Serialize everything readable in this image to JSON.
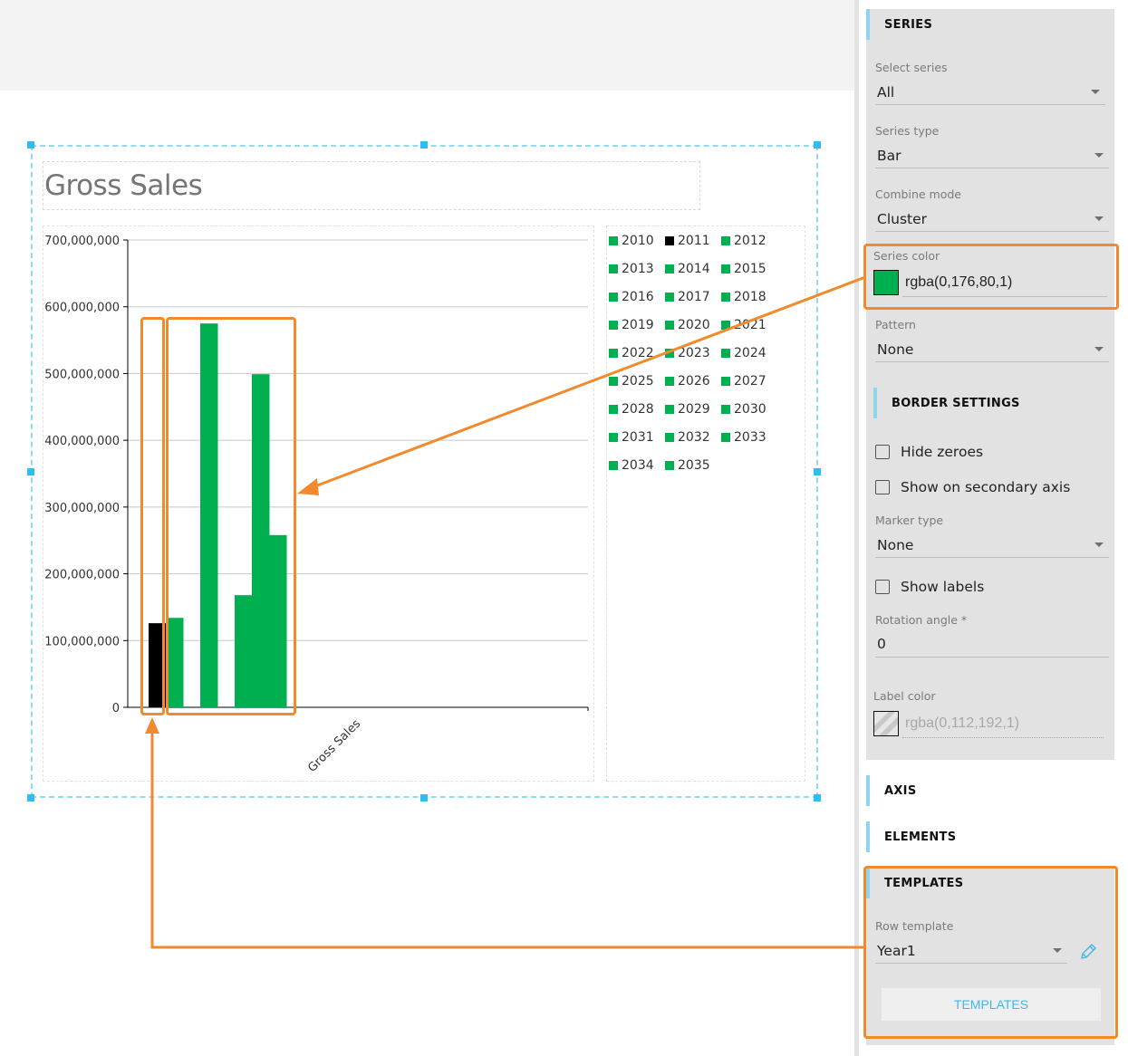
{
  "chart": {
    "title": "Gross Sales"
  },
  "chart_data": {
    "type": "bar",
    "title": "Gross Sales",
    "combine_mode": "cluster",
    "categories": [
      "Gross Sales"
    ],
    "xlabel": "",
    "ylabel": "",
    "ylim": [
      0,
      700000000
    ],
    "yticks": [
      0,
      100000000,
      200000000,
      300000000,
      400000000,
      500000000,
      600000000,
      700000000
    ],
    "ytick_labels": [
      "0",
      "100,000,000",
      "200,000,000",
      "300,000,000",
      "400,000,000",
      "500,000,000",
      "600,000,000",
      "700,000,000"
    ],
    "grid": true,
    "legend_position": "right",
    "series": [
      {
        "name": "2010",
        "color": "#00b050",
        "values": [
          0
        ]
      },
      {
        "name": "2011",
        "color": "#000000",
        "values": [
          126000000
        ]
      },
      {
        "name": "2012",
        "color": "#00b050",
        "values": [
          134000000
        ]
      },
      {
        "name": "2013",
        "color": "#00b050",
        "values": [
          0
        ]
      },
      {
        "name": "2014",
        "color": "#00b050",
        "values": [
          575000000
        ]
      },
      {
        "name": "2015",
        "color": "#00b050",
        "values": [
          0
        ]
      },
      {
        "name": "2016",
        "color": "#00b050",
        "values": [
          168000000
        ]
      },
      {
        "name": "2017",
        "color": "#00b050",
        "values": [
          499000000
        ]
      },
      {
        "name": "2018",
        "color": "#00b050",
        "values": [
          258000000
        ]
      },
      {
        "name": "2019",
        "color": "#00b050",
        "values": [
          0
        ]
      },
      {
        "name": "2020",
        "color": "#00b050",
        "values": [
          0
        ]
      },
      {
        "name": "2021",
        "color": "#00b050",
        "values": [
          0
        ]
      },
      {
        "name": "2022",
        "color": "#00b050",
        "values": [
          0
        ]
      },
      {
        "name": "2023",
        "color": "#00b050",
        "values": [
          0
        ]
      },
      {
        "name": "2024",
        "color": "#00b050",
        "values": [
          0
        ]
      },
      {
        "name": "2025",
        "color": "#00b050",
        "values": [
          0
        ]
      },
      {
        "name": "2026",
        "color": "#00b050",
        "values": [
          0
        ]
      },
      {
        "name": "2027",
        "color": "#00b050",
        "values": [
          0
        ]
      },
      {
        "name": "2028",
        "color": "#00b050",
        "values": [
          0
        ]
      },
      {
        "name": "2029",
        "color": "#00b050",
        "values": [
          0
        ]
      },
      {
        "name": "2030",
        "color": "#00b050",
        "values": [
          0
        ]
      },
      {
        "name": "2031",
        "color": "#00b050",
        "values": [
          0
        ]
      },
      {
        "name": "2032",
        "color": "#00b050",
        "values": [
          0
        ]
      },
      {
        "name": "2033",
        "color": "#00b050",
        "values": [
          0
        ]
      },
      {
        "name": "2034",
        "color": "#00b050",
        "values": [
          0
        ]
      },
      {
        "name": "2035",
        "color": "#00b050",
        "values": [
          0
        ]
      }
    ]
  },
  "panel": {
    "series_section": {
      "title": "SERIES",
      "select_series_label": "Select series",
      "select_series_value": "All",
      "series_type_label": "Series type",
      "series_type_value": "Bar",
      "combine_mode_label": "Combine mode",
      "combine_mode_value": "Cluster",
      "series_color_label": "Series color",
      "series_color_value": "rgba(0,176,80,1)",
      "series_color_hex": "#00b050",
      "pattern_label": "Pattern",
      "pattern_value": "None"
    },
    "border_section": {
      "title": "BORDER SETTINGS",
      "hide_zeroes_label": "Hide zeroes",
      "hide_zeroes_checked": false,
      "secondary_axis_label": "Show on secondary axis",
      "secondary_axis_checked": false,
      "marker_type_label": "Marker type",
      "marker_type_value": "None",
      "show_labels_label": "Show labels",
      "show_labels_checked": false,
      "rotation_angle_label": "Rotation angle *",
      "rotation_angle_value": "0",
      "label_color_label": "Label color",
      "label_color_value": "rgba(0,112,192,1)"
    },
    "axis_section": {
      "title": "AXIS"
    },
    "elements_section": {
      "title": "ELEMENTS"
    },
    "templates_section": {
      "title": "TEMPLATES",
      "row_template_label": "Row template",
      "row_template_value": "Year1",
      "templates_button": "TEMPLATES"
    }
  },
  "colors": {
    "accent": "#3cb7ec",
    "annotation": "#f08a2c",
    "selection": "#8fdcf2"
  }
}
